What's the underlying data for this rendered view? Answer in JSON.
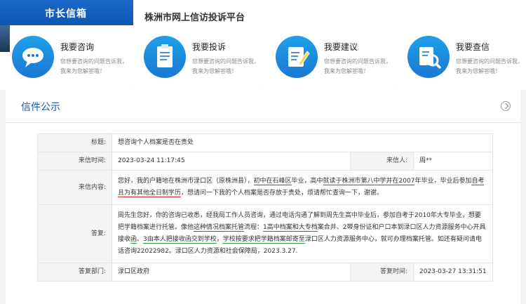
{
  "header": {
    "tab_label": "市长信箱",
    "platform_title": "株洲市网上信访投诉平台"
  },
  "cards": [
    {
      "title": "我要咨询",
      "desc": "您想要咨询的问题告诉我，我来为您解答哦！",
      "icon": "chat-bubble-icon"
    },
    {
      "title": "我要投诉",
      "desc": "您想要咨询的问题告诉我，我来为您解答哦！",
      "icon": "clipboard-icon"
    },
    {
      "title": "我要建议",
      "desc": "您想要咨询的问题告诉我，我来为您解答哦！",
      "icon": "edit-document-icon"
    },
    {
      "title": "我要查信",
      "desc": "您想要咨询的问题告诉我，我来为您解答哦！",
      "icon": "magnifier-icon"
    }
  ],
  "section": {
    "title": "信件公示"
  },
  "letter": {
    "subject_label": "标题:",
    "subject": "想咨询个人档案是否在贵处",
    "date_label": "来信时间:",
    "date": "2023-03-24 11:17:45",
    "sender_label": "来信人:",
    "sender": "周**",
    "content_label": "来信内容:",
    "content_1": "您好，我的户籍地在株洲市渌口区（原株洲县），",
    "content_2": "初中在石峰区",
    "content_3": "毕业，高中",
    "content_4": "就读于株洲市第八中学并在2007",
    "content_5": "年毕业，毕业后参加",
    "content_6": "自考且",
    "content_7": "为有其他全日制学历",
    "content_8": "，想请问一下我的个人档案是否存放于贵处，烦请帮忙查询一下，谢谢。",
    "reply_label": "答复:",
    "reply_1": "周先生您好，你的咨询已收悉，经我局工作人员咨询，通过电话沟通了解到周先生高中毕业后，参加自考于2010年大专毕业，想要把学籍档案进行托管。像他",
    "reply_2": "这种情况档案托管",
    "reply_3": "流程：",
    "reply_4": "1高中档案和大专档",
    "reply_5": "案合并、2带身份证和户口本到渌口区人力资源服务中心开具接收",
    "reply_6": "函",
    "reply_7": "、",
    "reply_8": "3由本人把接收函交到学校",
    "reply_9": "，",
    "reply_10": "学校按要求把学籍档案邮寄至",
    "reply_11": "渌口区人力资源服务中心，就可办理档案托管。如还有疑问请电话咨询22022982。渌口区人力资源和社会保障局，2023.3.27.",
    "dept_label": "答复部门:",
    "dept": "渌口区政府",
    "reply_date_label": "答复时间:",
    "reply_date": "2023-03-27 13:31:51"
  },
  "colors": {
    "brand_blue": "#1a69c9",
    "section_title": "#1a56a8",
    "annotation_red": "#d8262b",
    "annotation_green": "#2a9a3b"
  }
}
